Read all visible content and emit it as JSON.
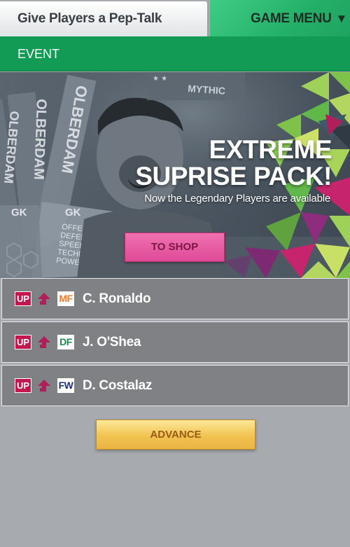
{
  "header": {
    "pep_talk_tab": "Give Players a Pep-Talk",
    "game_menu_tab": "GAME MENU",
    "game_menu_arrow": "▼"
  },
  "event_bar": {
    "label": "EVENT"
  },
  "banner": {
    "title_line1": "EXTREME",
    "title_line2": "SUPRISE PACK!",
    "subtitle": "Now the Legendary Players are available",
    "shop_button": "TO SHOP",
    "card_texts": {
      "mythic": "MYTHIC",
      "name_a": "OLBERDAM",
      "name_b": "OLBERDAM",
      "name_c": "OLBERDAM",
      "position": "GK",
      "stats": [
        "OFFENCE",
        "DEFENCE",
        "SPEED",
        "TECHNIQUE",
        "POWER"
      ]
    }
  },
  "players": [
    {
      "up": "UP",
      "position": "MF",
      "position_color": "#f07c2b",
      "name": "C. Ronaldo"
    },
    {
      "up": "UP",
      "position": "DF",
      "position_color": "#1f8a4a",
      "name": "J. O'Shea"
    },
    {
      "up": "UP",
      "position": "FW",
      "position_color": "#1f2f7a",
      "name": "D. Costalaz"
    }
  ],
  "advance_button": "ADVANCE",
  "colors": {
    "accent_green": "#129b54",
    "shop_pink": "#e04a97",
    "up_red": "#c3174f",
    "advance_gold": "#f2c351"
  }
}
